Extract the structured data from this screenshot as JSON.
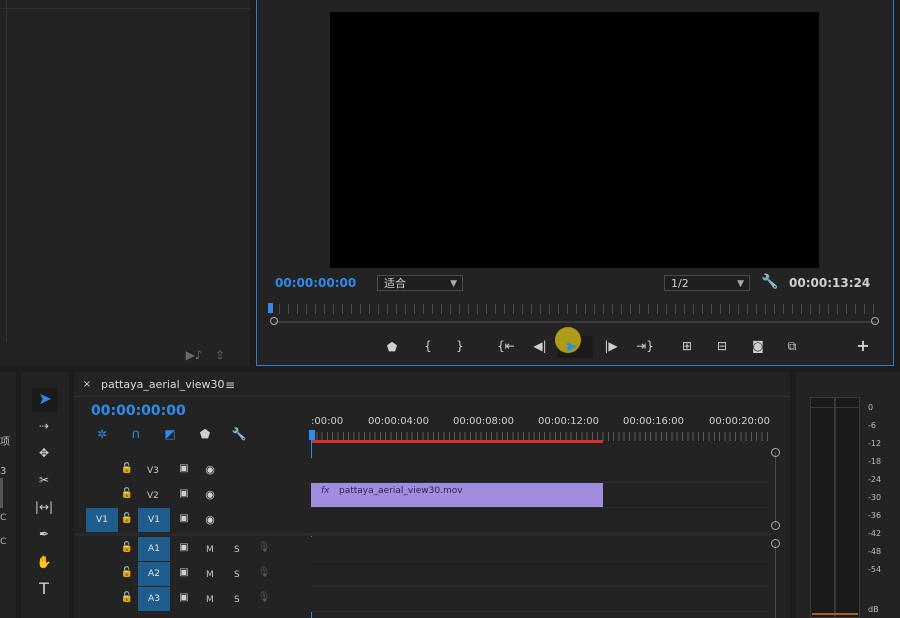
{
  "program_monitor": {
    "timecode_current": "00:00:00:00",
    "fit_select": "适合",
    "resolution_select": "1/2",
    "timecode_duration": "00:00:13:24"
  },
  "sequence": {
    "tab_name": "pattaya_aerial_view30",
    "playhead_timecode": "00:00:00:00",
    "ruler_labels": [
      ":00:00",
      "00:00:04:00",
      "00:00:08:00",
      "00:00:12:00",
      "00:00:16:00",
      "00:00:20:00"
    ],
    "tracks": {
      "v3": "V3",
      "v2": "V2",
      "v1": "V1",
      "v1_source": "V1",
      "a1": "A1",
      "a2": "A2",
      "a3": "A3",
      "mute": "M",
      "solo": "S"
    },
    "clip": {
      "fx": "fx",
      "name": "pattaya_aerial_view30.mov"
    }
  },
  "left_panel_fragments": [
    "项",
    "3",
    "C",
    "C"
  ],
  "audio_meter": {
    "labels": [
      "0",
      "-6",
      "-12",
      "-18",
      "-24",
      "-30",
      "-36",
      "-42",
      "-48",
      "-54",
      "dB"
    ]
  },
  "colors": {
    "accent_blue": "#2d8ceb",
    "clip_purple": "#a08de0",
    "work_area_red": "#e02c2c",
    "track_target_blue": "#1e5d8c",
    "cursor_highlight": "#c8b21a"
  }
}
